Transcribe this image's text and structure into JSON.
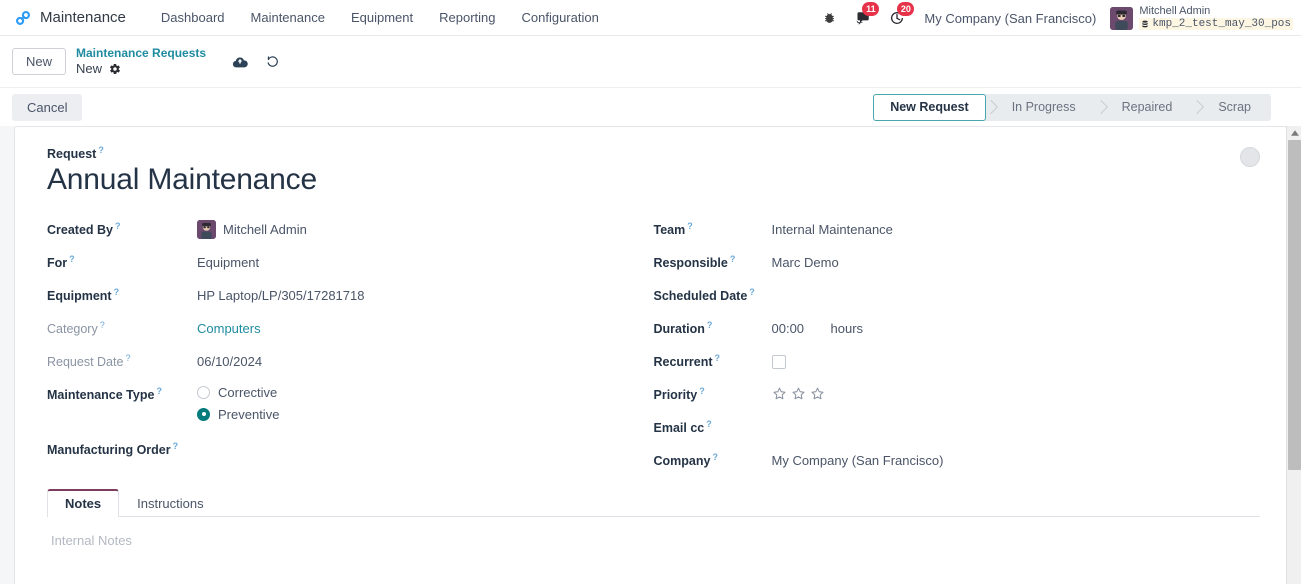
{
  "navbar": {
    "logo_icon": "link-chain-icon",
    "brand": "Maintenance",
    "menu": [
      {
        "label": "Dashboard"
      },
      {
        "label": "Maintenance"
      },
      {
        "label": "Equipment"
      },
      {
        "label": "Reporting"
      },
      {
        "label": "Configuration"
      }
    ],
    "sys_icons": [
      {
        "icon": "bug-icon",
        "badge": ""
      },
      {
        "icon": "messages-icon",
        "badge": "11"
      },
      {
        "icon": "activities-clock-icon",
        "badge": "20"
      }
    ],
    "company": "My Company (San Francisco)",
    "user": {
      "name": "Mitchell Admin",
      "database": "kmp_2_test_may_30_pos",
      "db_icon": "database-icon",
      "avatar_icon": "user-avatar"
    }
  },
  "control_panel": {
    "new_button": "New",
    "breadcrumb_parent": "Maintenance Requests",
    "breadcrumb_current": "New",
    "gear_icon": "gear-icon",
    "save_icon": "cloud-save-icon",
    "discard_icon": "discard-undo-icon",
    "cancel_button": "Cancel",
    "stages": [
      {
        "label": "New Request",
        "active": true
      },
      {
        "label": "In Progress",
        "active": false
      },
      {
        "label": "Repaired",
        "active": false
      },
      {
        "label": "Scrap",
        "active": false
      }
    ]
  },
  "form": {
    "request_label": "Request",
    "title": "Annual Maintenance",
    "help_marker": "?",
    "left_fields": [
      {
        "label": "Created By",
        "value": "Mitchell Admin",
        "muted_label": false,
        "type": "avatar"
      },
      {
        "label": "For",
        "value": "Equipment",
        "muted_label": false,
        "type": "text"
      },
      {
        "label": "Equipment",
        "value": "HP Laptop/LP/305/17281718",
        "muted_label": false,
        "type": "text"
      },
      {
        "label": "Category",
        "value": "Computers",
        "muted_label": true,
        "type": "link"
      },
      {
        "label": "Request Date",
        "value": "06/10/2024",
        "muted_label": true,
        "type": "text"
      }
    ],
    "maintenance_type": {
      "label": "Maintenance Type",
      "options": [
        {
          "label": "Corrective",
          "selected": false
        },
        {
          "label": "Preventive",
          "selected": true
        }
      ]
    },
    "manufacturing_order": {
      "label": "Manufacturing Order",
      "value": ""
    },
    "right_fields": [
      {
        "label": "Team",
        "value": "Internal Maintenance",
        "type": "text"
      },
      {
        "label": "Responsible",
        "value": "Marc Demo",
        "type": "text"
      },
      {
        "label": "Scheduled Date",
        "value": "",
        "type": "text"
      }
    ],
    "duration": {
      "label": "Duration",
      "value": "00:00",
      "unit": "hours"
    },
    "recurrent": {
      "label": "Recurrent",
      "checked": false
    },
    "priority": {
      "label": "Priority",
      "stars_total": 3,
      "stars_filled": 0
    },
    "email_cc": {
      "label": "Email cc",
      "value": ""
    },
    "company": {
      "label": "Company",
      "value": "My Company (San Francisco)"
    },
    "avatar_placeholder": "avatar-placeholder-circle"
  },
  "tabs": {
    "items": [
      {
        "label": "Notes",
        "active": true
      },
      {
        "label": "Instructions",
        "active": false
      }
    ],
    "notes_placeholder": "Internal Notes"
  },
  "colors": {
    "accent_teal": "#1f8ba0",
    "badge_red": "#e6334a",
    "radio_selected": "#047c7c",
    "tab_active_border": "#7c3d5e",
    "logo_blue": "#2f9cf4"
  }
}
